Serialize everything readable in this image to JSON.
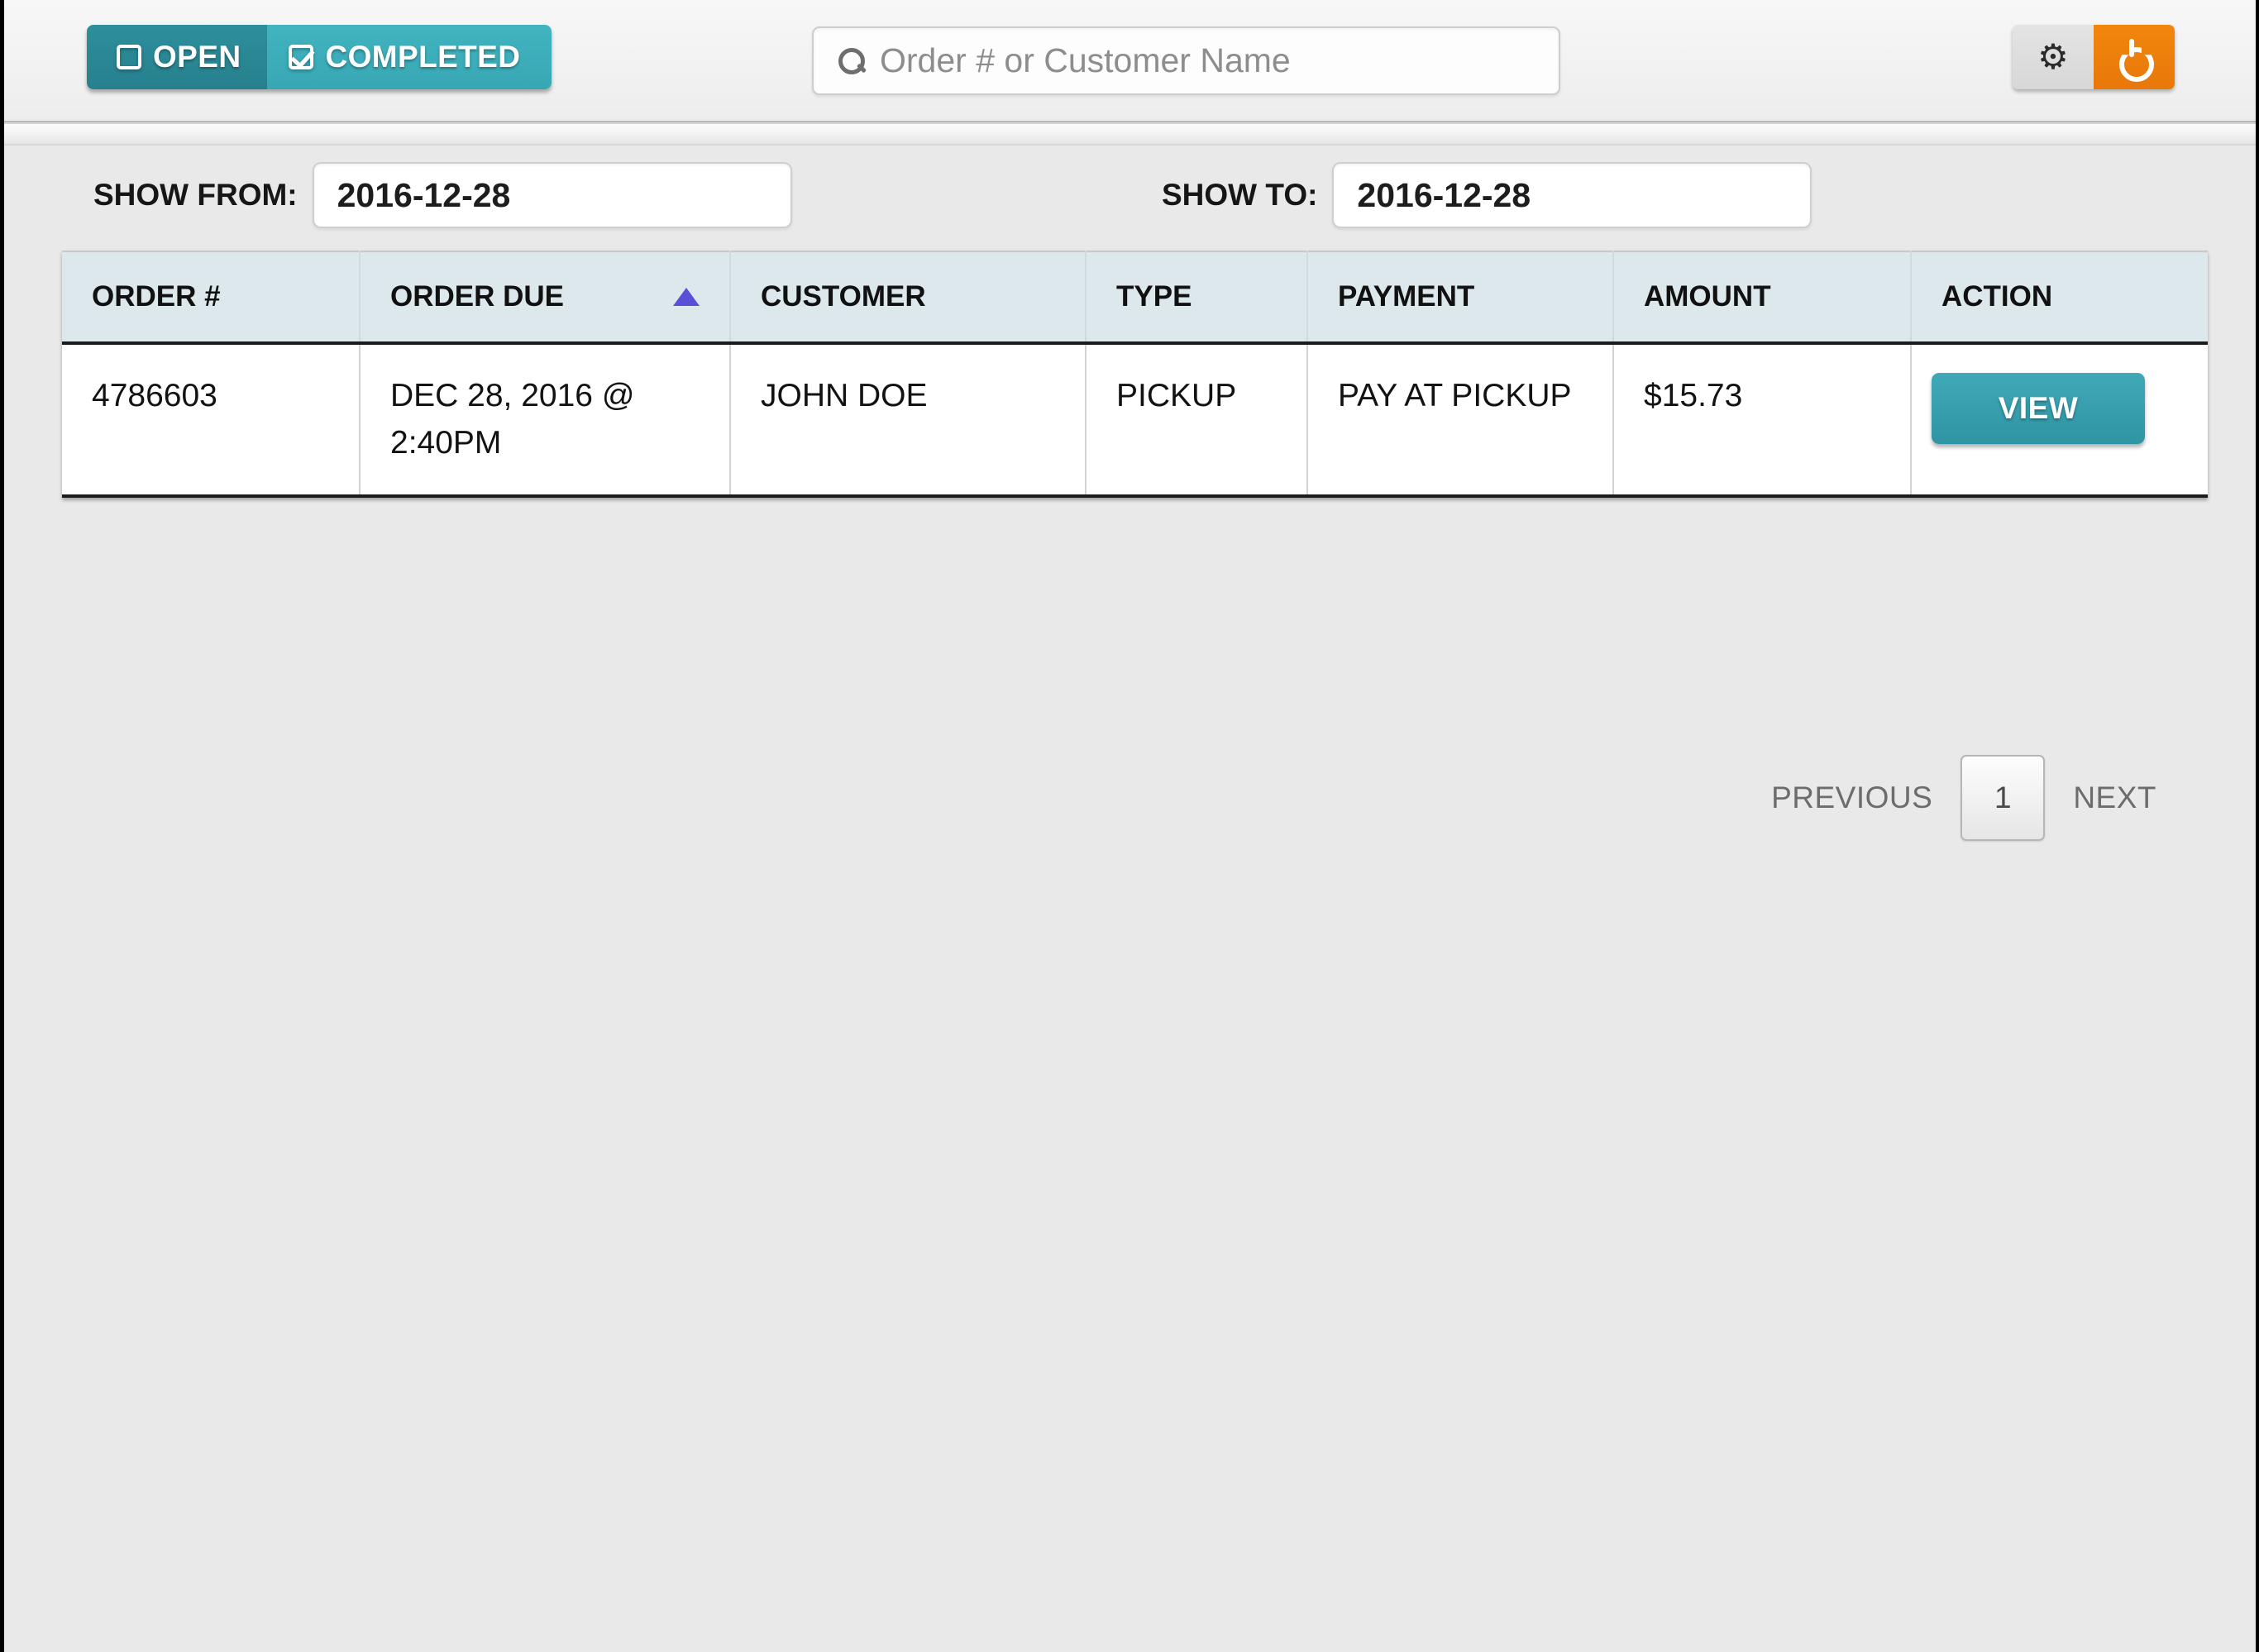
{
  "topbar": {
    "toggles": [
      {
        "label": "OPEN",
        "icon": "checkbox-unchecked-icon",
        "checked": false,
        "color": "#2d8f9c"
      },
      {
        "label": "COMPLETED",
        "icon": "checkbox-checked-icon",
        "checked": true,
        "color": "#41b4c0"
      }
    ],
    "search": {
      "icon": "search-icon",
      "placeholder": "Order # or Customer Name",
      "value": ""
    },
    "actions": [
      {
        "name": "settings-button",
        "icon": "gear-icon",
        "glyph": "⚙",
        "color": "#dedede"
      },
      {
        "name": "power-button",
        "icon": "power-icon",
        "glyph": "⏻",
        "color": "#ef800c"
      }
    ]
  },
  "filters": {
    "from_label": "SHOW FROM:",
    "from_value": "2016-12-28",
    "to_label": "SHOW TO:",
    "to_value": "2016-12-28"
  },
  "table": {
    "columns": [
      {
        "label": "ORDER #",
        "sorted": false
      },
      {
        "label": "ORDER DUE",
        "sorted": true,
        "direction": "asc",
        "arrow_color": "#5b4fd8"
      },
      {
        "label": "CUSTOMER",
        "sorted": false
      },
      {
        "label": "TYPE",
        "sorted": false
      },
      {
        "label": "PAYMENT",
        "sorted": false
      },
      {
        "label": "AMOUNT",
        "sorted": false
      },
      {
        "label": "ACTION",
        "sorted": false
      }
    ],
    "rows": [
      {
        "order_number": "4786603",
        "order_due": "DEC 28, 2016 @ 2:40PM",
        "customer": "JOHN DOE",
        "type": "PICKUP",
        "payment": "PAY AT PICKUP",
        "amount": "$15.73",
        "action_label": "VIEW"
      }
    ]
  },
  "pagination": {
    "previous_label": "PREVIOUS",
    "current_page": "1",
    "next_label": "NEXT"
  },
  "colors": {
    "teal_dark": "#2d8f9c",
    "teal_light": "#41b4c0",
    "orange": "#ef800c",
    "header_bg": "#dde8ed",
    "page_bg": "#e9e9e9",
    "sort_arrow": "#5b4fd8"
  }
}
